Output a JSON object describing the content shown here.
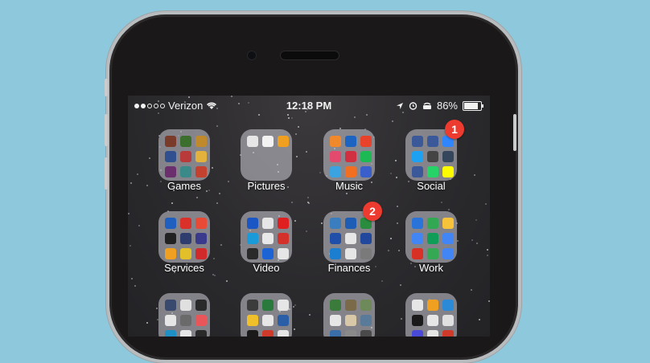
{
  "status_bar": {
    "signal_strength": 2,
    "carrier": "Verizon",
    "wifi_icon": "wifi-icon",
    "time": "12:18 PM",
    "battery_percent": "86%",
    "battery_level": 0.86
  },
  "folders": [
    {
      "id": "games",
      "label": "Games",
      "badge": null,
      "icons": [
        "#7a3b2a",
        "#3c6e2e",
        "#c08a2c",
        "#2f4f8f",
        "#b83a3a",
        "#e2b23c",
        "#6b2f6e",
        "#3b8a8a",
        "#c4412f"
      ]
    },
    {
      "id": "pictures",
      "label": "Pictures",
      "badge": null,
      "icons": [
        "#e6e6e6",
        "#f2f2f2",
        "#f0a020"
      ]
    },
    {
      "id": "music",
      "label": "Music",
      "badge": null,
      "icons": [
        "#f0892c",
        "#1c64c2",
        "#e8432a",
        "#e44a6e",
        "#d03040",
        "#1db954",
        "#3aa3e0",
        "#f26f21",
        "#3a5fcb"
      ]
    },
    {
      "id": "social",
      "label": "Social",
      "badge": "1",
      "icons": [
        "#3b5998",
        "#3b5998",
        "#2f86ff",
        "#1da1f2",
        "#444444",
        "#35465c",
        "#3b5998",
        "#25d366",
        "#fffc00"
      ]
    },
    {
      "id": "services",
      "label": "Services",
      "badge": null,
      "icons": [
        "#1f5fbf",
        "#d9302a",
        "#e84a36",
        "#222222",
        "#2f3d6e",
        "#3a3a8c",
        "#f0a020",
        "#e2c02a",
        "#d02a2a"
      ]
    },
    {
      "id": "video",
      "label": "Video",
      "badge": null,
      "icons": [
        "#1a56c4",
        "#e6e6e6",
        "#e02020",
        "#1a9ad8",
        "#e8e8e8",
        "#d4312a",
        "#2a2a2a",
        "#1c63d6",
        "#e6e6e6"
      ]
    },
    {
      "id": "finances",
      "label": "Finances",
      "badge": "2",
      "icons": [
        "#3a7ebf",
        "#1e5db5",
        "#2a8c3e",
        "#1f4fa8",
        "#e6e6e6",
        "#21489c",
        "#1b7ed0",
        "#e6e6e6",
        "#7a7a7a"
      ]
    },
    {
      "id": "work",
      "label": "Work",
      "badge": null,
      "icons": [
        "#2a73d9",
        "#33a852",
        "#f6c33b",
        "#4285f4",
        "#0f9d58",
        "#4285f4",
        "#d93025",
        "#34a853",
        "#4285f4"
      ]
    },
    {
      "id": "row3-1",
      "label": "",
      "badge": null,
      "icons": [
        "#3a4a6e",
        "#e0e0e0",
        "#2a2a2a",
        "#e6e6e6",
        "#6a6a6a",
        "#e8565a",
        "#1e90c4",
        "#e6e6e6",
        "#2a2a2a"
      ]
    },
    {
      "id": "row3-2",
      "label": "",
      "badge": null,
      "icons": [
        "#3c3c3c",
        "#2a7a3e",
        "#e6e6e6",
        "#f0c02a",
        "#e6e6e6",
        "#2a5fa8",
        "#1a1a1a",
        "#d03a2a",
        "#e6e6e6"
      ]
    },
    {
      "id": "row3-3",
      "label": "",
      "badge": null,
      "icons": [
        "#3a7a3a",
        "#7a6a4a",
        "#6e8a5a",
        "#e6e6e6",
        "#d8c8a8",
        "#5a7a9a",
        "#3a6ea8",
        "#8a8a8a",
        "#4a4a4a"
      ]
    },
    {
      "id": "row3-4",
      "label": "",
      "badge": null,
      "icons": [
        "#e6e6e6",
        "#f0a020",
        "#2a8ad8",
        "#1a1a1a",
        "#e6e6e6",
        "#e0e0e0",
        "#4a4ad8",
        "#e6e6e6",
        "#d03a2a"
      ]
    }
  ]
}
